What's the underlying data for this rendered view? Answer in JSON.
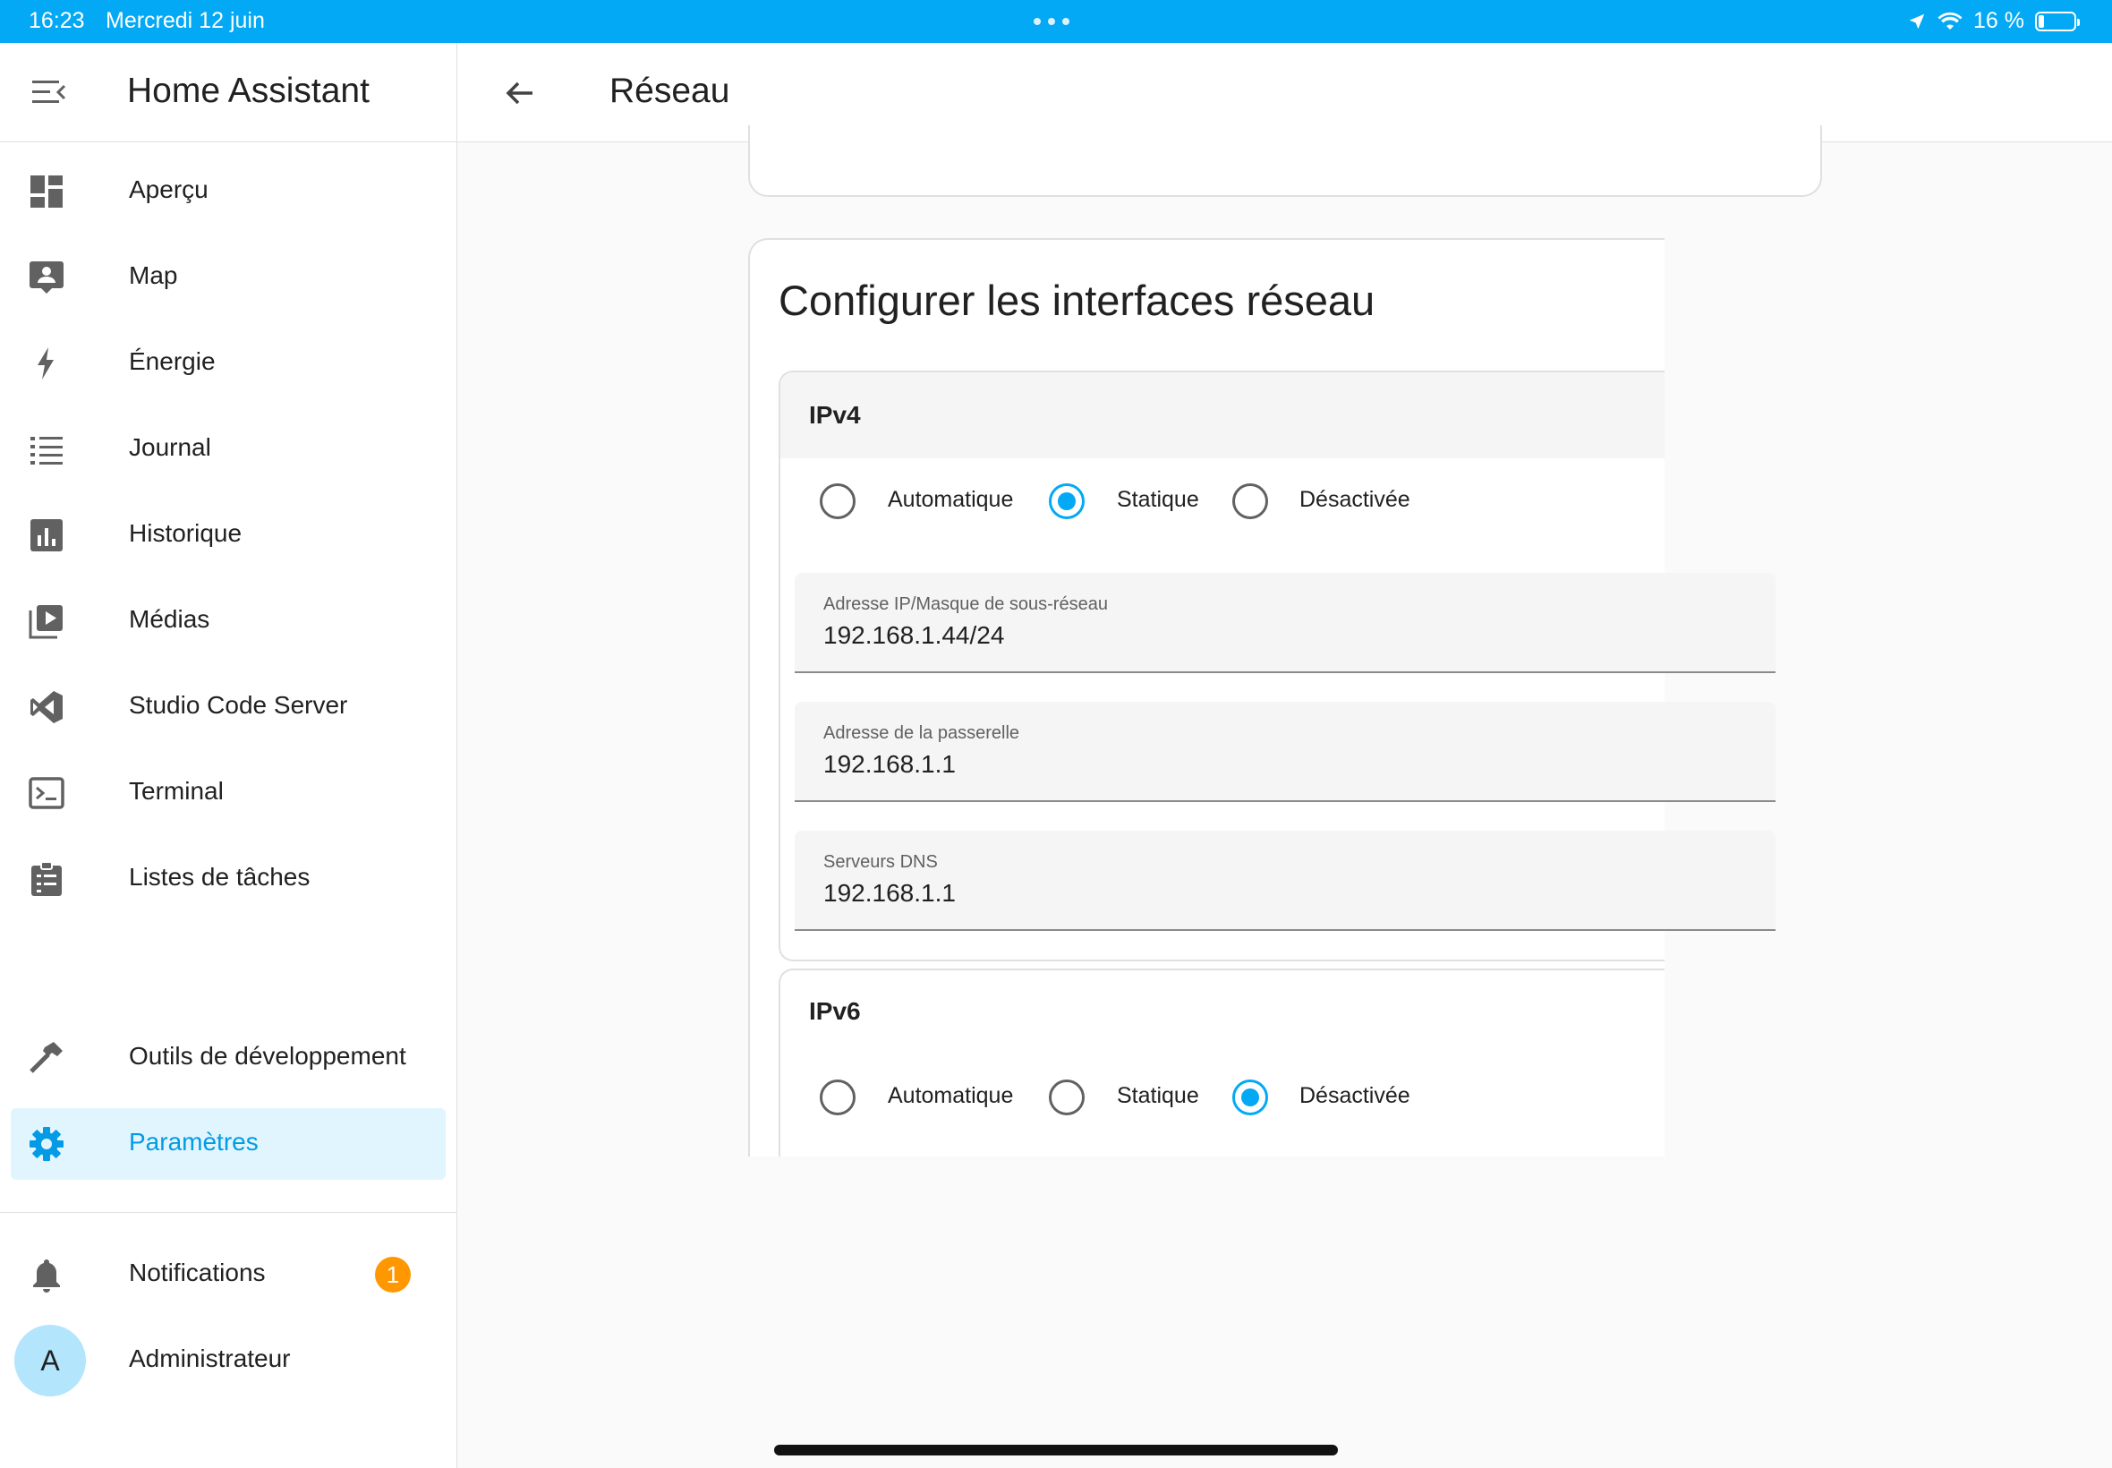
{
  "status_bar": {
    "time": "16:23",
    "date": "Mercredi 12 juin",
    "battery": "16 %",
    "battery_level": 0.16
  },
  "sidebar": {
    "title": "Home Assistant",
    "items": [
      {
        "label": "Aperçu",
        "icon": "dashboard-icon"
      },
      {
        "label": "Map",
        "icon": "map-account-icon"
      },
      {
        "label": "Énergie",
        "icon": "lightning-icon"
      },
      {
        "label": "Journal",
        "icon": "list-icon"
      },
      {
        "label": "Historique",
        "icon": "chart-box-icon"
      },
      {
        "label": "Médias",
        "icon": "play-box-multiple-icon"
      },
      {
        "label": "Studio Code Server",
        "icon": "vscode-icon"
      },
      {
        "label": "Terminal",
        "icon": "console-icon"
      },
      {
        "label": "Listes de tâches",
        "icon": "clipboard-list-icon"
      }
    ],
    "dev_tools": "Outils de développement",
    "settings": "Paramètres",
    "notifications": "Notifications",
    "notifications_count": "1",
    "user_initial": "A",
    "user": "Administrateur"
  },
  "topbar": {
    "title": "Réseau"
  },
  "network": {
    "card_title": "Configurer les interfaces réseau",
    "ipv4": {
      "title": "IPv4",
      "options": [
        "Automatique",
        "Statique",
        "Désactivée"
      ],
      "selected": "Statique",
      "fields": [
        {
          "label": "Adresse IP/Masque de sous-réseau",
          "value": "192.168.1.44/24"
        },
        {
          "label": "Adresse de la passerelle",
          "value": "192.168.1.1"
        },
        {
          "label": "Serveurs DNS",
          "value": "192.168.1.1"
        }
      ]
    },
    "ipv6": {
      "title": "IPv6",
      "options": [
        "Automatique",
        "Statique",
        "Désactivée"
      ],
      "selected": "Désactivée"
    }
  },
  "colors": {
    "primary": "#03a9f4",
    "badge": "#ff9800",
    "active_bg": "#e1f5fe"
  }
}
